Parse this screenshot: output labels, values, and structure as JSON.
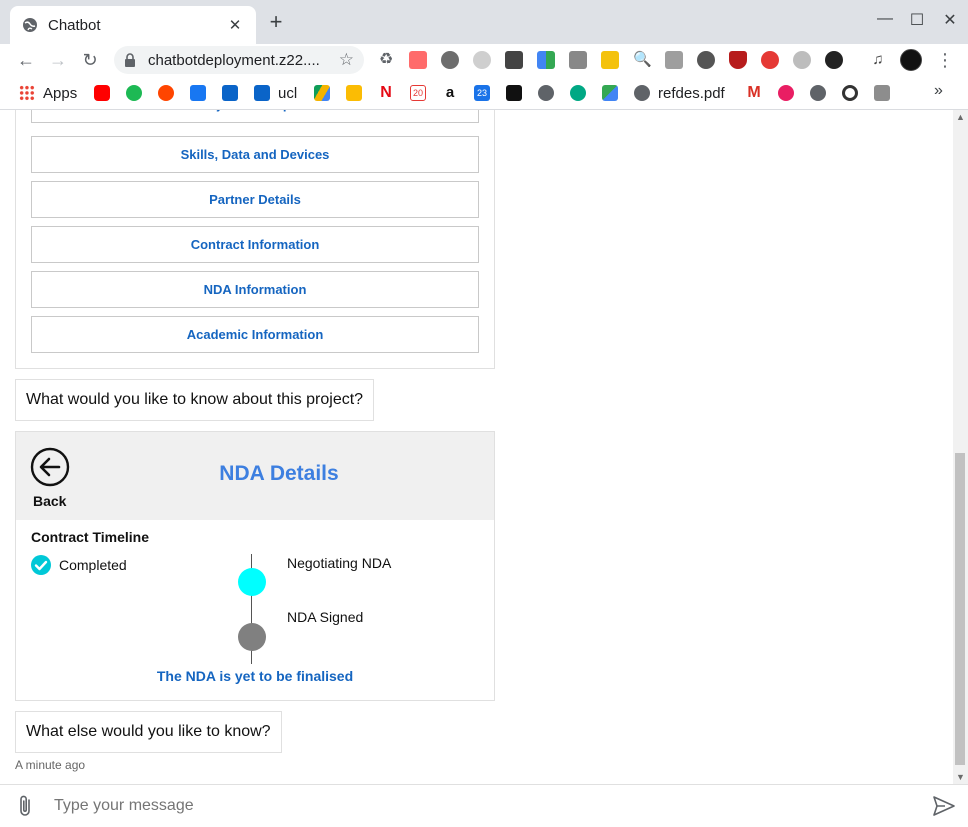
{
  "browser": {
    "tab_title": "Chatbot",
    "url": "chatbotdeployment.z22....",
    "bookmarks": {
      "apps": "Apps",
      "ucl": "ucl",
      "refdes": "refdes.pdf"
    }
  },
  "chat": {
    "menu_buttons": [
      "Project Description",
      "Skills, Data and Devices",
      "Partner Details",
      "Contract Information",
      "NDA Information",
      "Academic Information"
    ],
    "bot_question_1": "What would you like to know about this project?",
    "nda_card": {
      "back_label": "Back",
      "title": "NDA Details",
      "timeline_title": "Contract Timeline",
      "legend_completed": "Completed",
      "steps": [
        {
          "label": "Negotiating NDA",
          "color": "#00ffff"
        },
        {
          "label": "NDA Signed",
          "color": "#808080"
        }
      ],
      "status": "The NDA is yet to be finalised"
    },
    "bot_question_2": "What else would you like to know?",
    "timestamp": "A minute ago"
  },
  "composer": {
    "placeholder": "Type your message"
  },
  "colors": {
    "link_blue": "#1565c0",
    "title_blue": "#3d7fe0",
    "check_teal": "#00c8d7"
  }
}
